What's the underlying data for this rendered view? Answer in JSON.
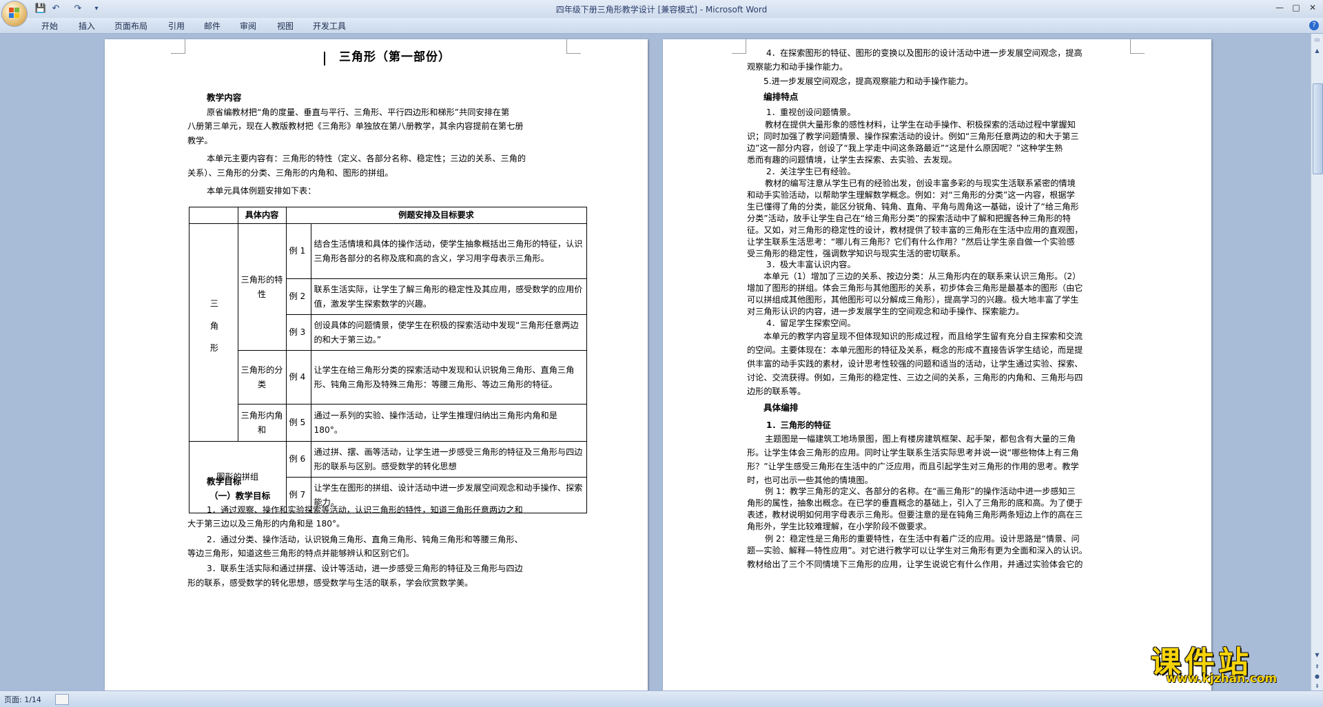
{
  "window": {
    "title": "四年级下册三角形教学设计 [兼容模式] - Microsoft Word",
    "minimize": "—",
    "maximize": "□",
    "close": "✕"
  },
  "quick_access": {
    "save": "💾",
    "undo": "↶",
    "redo": "↷",
    "customize": "▾"
  },
  "ribbon": {
    "tabs": [
      "开始",
      "插入",
      "页面布局",
      "引用",
      "邮件",
      "审阅",
      "视图",
      "开发工具"
    ],
    "help": "?"
  },
  "page1": {
    "title": "三角形（第一部份）",
    "h_content": "教学内容",
    "p1_lines": [
      "原省编教材把“角的度量、垂直与平行、三角形、平行四边形和梯形”共同安排在第",
      "八册第三单元，现在人教版教材把《三角形》单独放在第八册教学，其余内容提前在第七册",
      "教学。"
    ],
    "p2_lines": [
      "本单元主要内容有：三角形的特性（定义、各部分名称、稳定性；三边的关系、三角的",
      "关系）、三角形的分类、三角形的内角和、图形的拼组。"
    ],
    "p3": "本单元具体例题安排如下表：",
    "table": {
      "head_content": "具体内容",
      "head_req": "例题安排及目标要求",
      "group_main_label": "三角形",
      "rows": [
        {
          "group": "三角形的特性",
          "ex": "例 1",
          "text": "结合生活情境和具体的操作活动，使学生抽象概括出三角形的特征，认识三角形各部分的名称及底和高的含义，学习用字母表示三角形。"
        },
        {
          "ex": "例 2",
          "text": "联系生活实际，让学生了解三角形的稳定性及其应用，感受数学的应用价值，激发学生探索数学的兴趣。"
        },
        {
          "ex": "例 3",
          "text": "创设具体的问题情景，使学生在积极的探索活动中发现“三角形任意两边的和大于第三边。”"
        },
        {
          "group": "三角形的分类",
          "ex": "例 4",
          "text": "让学生在给三角形分类的探索活动中发现和认识锐角三角形、直角三角形、钝角三角形及特殊三角形：等腰三角形、等边三角形的特征。"
        },
        {
          "group": "三角形内角和",
          "ex": "例 5",
          "text": "通过一系列的实验、操作活动，让学生推理归纳出三角形内角和是 180°。"
        },
        {
          "group": "图形的拼组",
          "ex": "例 6",
          "text": "通过拼、摆、画等活动，让学生进一步感受三角形的特征及三角形与四边形的联系与区别。感受数学的转化思想"
        },
        {
          "ex": "例 7",
          "text": "让学生在图形的拼组、设计活动中进一步发展空间观念和动手操作、探索能力。"
        }
      ]
    },
    "h_goal": "教学目标",
    "h_goal_sub": "（一）教学目标",
    "goal_lines": [
      "1．通过观察、操作和实验探索等活动，认识三角形的特性，知道三角形任意两边之和",
      "大于第三边以及三角形的内角和是 180°。",
      "2．通过分类、操作活动，认识锐角三角形、直角三角形、钝角三角形和等腰三角形、",
      "等边三角形，知道这些三角形的特点并能够辨认和区别它们。",
      "3．联系生活实际和通过拼摆、设计等活动，进一步感受三角形的特征及三角形与四边",
      "形的联系，感受数学的转化思想，感受数学与生活的联系，学会欣赏数学美。"
    ]
  },
  "page2": {
    "g4_lines": [
      "4．在探索图形的特征、图形的变换以及图形的设计活动中进一步发展空间观念，提高",
      "观察能力和动手操作能力。"
    ],
    "g5": "5.进一步发展空间观念，提高观察能力和动手操作能力。",
    "h_feature": "编排特点",
    "f1": "1．重视创设问题情景。",
    "f1_lines": [
      "教材在提供大量形象的感性材料，让学生在动手操作、积极探索的活动过程中掌握知",
      "识；同时加强了教学问题情景、操作探索活动的设计。例如“三角形任意两边的和大于第三",
      "边”这一部分内容，创设了“我上学走中间这条路最近”“这是什么原因呢？”这种学生熟",
      "悉而有趣的问题情境，让学生去探索、去实验、去发现。"
    ],
    "f2": "2．关注学生已有经验。",
    "f2_lines": [
      "教材的编写注意从学生已有的经验出发，创设丰富多彩的与现实生活联系紧密的情境",
      "和动手实验活动，以帮助学生理解数学概念。例如：对“三角形的分类”这一内容，根据学",
      "生已懂得了角的分类，能区分锐角、钝角、直角、平角与周角这一基础，设计了“给三角形",
      "分类”活动，放手让学生自己在“给三角形分类”的探索活动中了解和把握各种三角形的特",
      "征。又如，对三角形的稳定性的设计，教材提供了较丰富的三角形在生活中应用的直观图，",
      "让学生联系生活思考：“哪儿有三角形？它们有什么作用？”然后让学生亲自做一个实验感",
      "受三角形的稳定性，强调数学知识与现实生活的密切联系。"
    ],
    "f3": "3．极大丰富认识内容。",
    "f3_lines": [
      "本单元（1）增加了三边的关系、按边分类：从三角形内在的联系来认识三角形。（2）",
      "增加了图形的拼组。体会三角形与其他图形的关系，初步体会三角形是最基本的图形（由它",
      "可以拼组成其他图形，其他图形可以分解成三角形），提高学习的兴趣。极大地丰富了学生",
      "对三角形认识的内容，进一步发展学生的空间观念和动手操作、探索能力。"
    ],
    "f4": "4．留足学生探索空间。",
    "f4_lines": [
      "本单元的教学内容呈现不但体现知识的形成过程，而且给学生留有充分自主探索和交流",
      "的空间。主要体现在：本单元图形的特征及关系，概念的形成不直接告诉学生结论，而是提",
      "供丰富的动手实践的素材，设计思考性较强的问题和适当的活动，让学生通过实验、探索、",
      "讨论、交流获得。例如，三角形的稳定性、三边之间的关系，三角形的内角和、三角形与四",
      "边形的联系等。"
    ],
    "h_specific": "具体编排",
    "s1": "1．三角形的特征",
    "s1_lines": [
      "主题图是一幅建筑工地场景图，图上有楼房建筑框架、起手架，都包含有大量的三角",
      "形。让学生体会三角形的应用。同时让学生联系生活实际思考并说一说“哪些物体上有三角",
      "形？”让学生感受三角形在生活中的广泛应用，而且引起学生对三角形的作用的思考。教学",
      "时，也可出示一些其他的情境图。"
    ],
    "ex1_lines": [
      "例 1：教学三角形的定义、各部分的名称。在“画三角形”的操作活动中进一步感知三",
      "角形的属性，抽象出概念。在已学的垂直概念的基础上，引入了三角形的底和高。为了便于",
      "表述，教材说明如何用字母表示三角形。但要注意的是在钝角三角形两条短边上作的高在三",
      "角形外，学生比较难理解，在小学阶段不做要求。"
    ],
    "ex2_lines": [
      "例 2：稳定性是三角形的重要特性，在生活中有着广泛的应用。设计思路是“情景、问",
      "题—实验、解释—特性应用”。对它进行教学可以让学生对三角形有更为全面和深入的认识。",
      "教材给出了三个不同情境下三角形的应用，让学生说说它有什么作用，并通过实验体会它的"
    ]
  },
  "status": {
    "page": "页面: 1/14"
  },
  "watermark": {
    "title": "课件站",
    "url": "www.kjzhan.com"
  }
}
